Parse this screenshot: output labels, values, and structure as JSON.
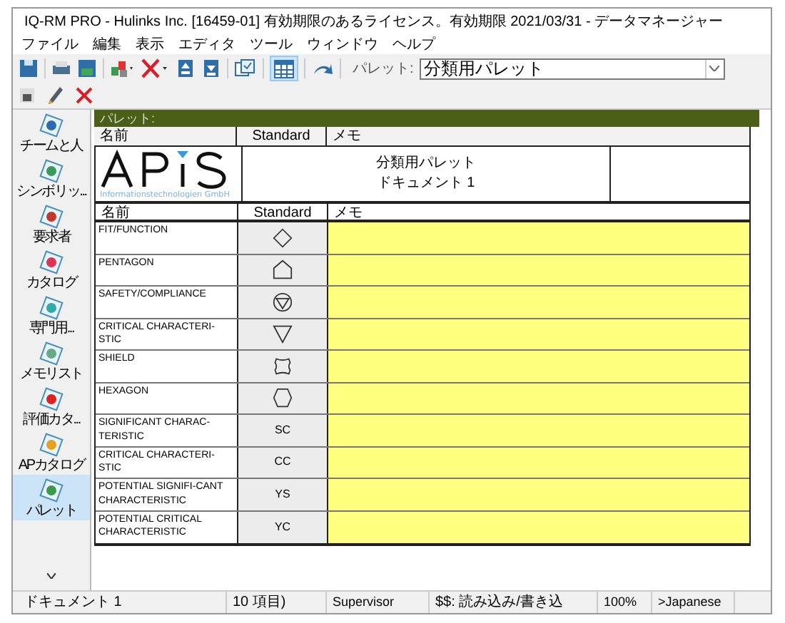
{
  "window": {
    "title": "IQ-RM PRO - Hulinks Inc. [16459-01] 有効期限のあるライセンス。有効期限 2021/03/31 - データマネージャー"
  },
  "menu": [
    "ファイル",
    "編集",
    "表示",
    "エディタ",
    "ツール",
    "ウィンドウ",
    "ヘルプ"
  ],
  "toolbar": {
    "palette_label": "パレット:",
    "palette_value": "分類用パレット",
    "grid_view_selected": true
  },
  "sidebar": {
    "items": [
      {
        "label": "チームと人",
        "selected": false
      },
      {
        "label": "シンボリッ...",
        "selected": false
      },
      {
        "label": "要求者",
        "selected": false
      },
      {
        "label": "カタログ",
        "selected": false
      },
      {
        "label": "専門用...",
        "selected": false
      },
      {
        "label": "メモリスト",
        "selected": false
      },
      {
        "label": "評価カタ...",
        "selected": false
      },
      {
        "label": "APカタログ",
        "selected": false
      },
      {
        "label": "パレット",
        "selected": true
      }
    ]
  },
  "palette": {
    "header": "パレット:",
    "columns": [
      "名前",
      "Standard",
      "メモ"
    ],
    "logo": {
      "subtitle": "Informationstechnologien GmbH"
    },
    "title_lines": [
      "分類用パレット",
      "ドキュメント 1"
    ],
    "columns_2": [
      "名前",
      "Standard",
      "メモ"
    ],
    "rows": [
      {
        "name": "FIT/FUNCTION",
        "kind": "diamond"
      },
      {
        "name": "PENTAGON",
        "kind": "pentagon"
      },
      {
        "name": "SAFETY/COMPLIANCE",
        "kind": "roundel"
      },
      {
        "name": "CRITICAL CHARACTERI-STIC",
        "kind": "triangle"
      },
      {
        "name": "SHIELD",
        "kind": "shield"
      },
      {
        "name": "HEXAGON",
        "kind": "hexagon"
      },
      {
        "name": "SIGNIFICANT CHARAC-TERISTIC",
        "kind": "code",
        "code": "SC"
      },
      {
        "name": "CRITICAL CHARACTERI-STIC",
        "kind": "code",
        "code": "CC"
      },
      {
        "name": "POTENTIAL SIGNIFI-CANT CHARACTERISTIC",
        "kind": "code",
        "code": "YS"
      },
      {
        "name": "POTENTIAL CRITICAL CHARACTERISTIC",
        "kind": "code",
        "code": "YC"
      }
    ]
  },
  "status_bar": [
    "ドキュメント 1",
    "10 項目)",
    "Supervisor",
    "$$: 読み込み/書き込",
    "100%",
    ">Japanese"
  ]
}
